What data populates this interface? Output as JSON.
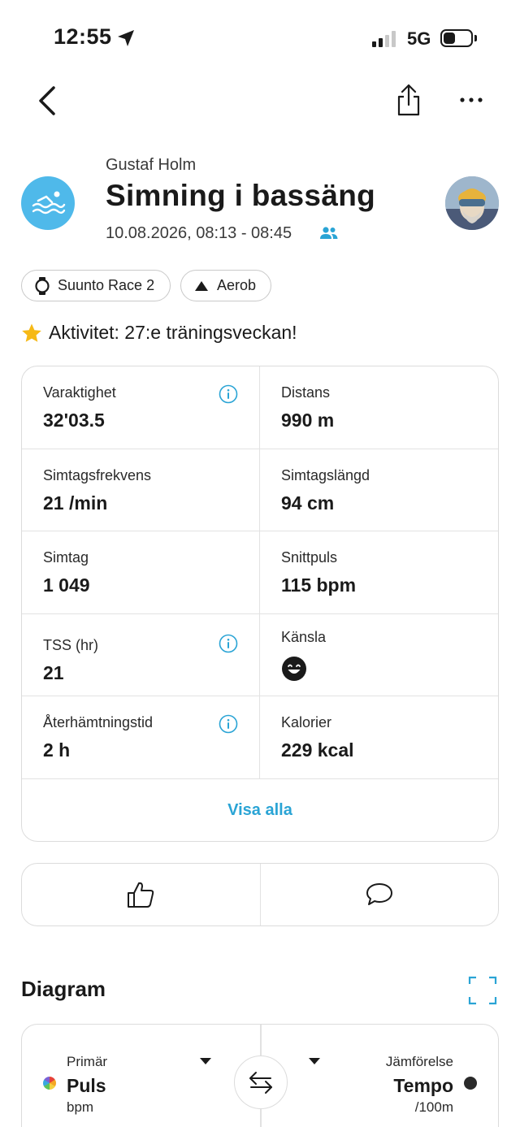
{
  "status_bar": {
    "time": "12:55",
    "network": "5G"
  },
  "header": {
    "owner": "Gustaf Holm",
    "title": "Simning i bassäng",
    "date": "10.08.2026, 08:13 - 08:45"
  },
  "chips": {
    "device": "Suunto Race 2",
    "zone": "Aerob"
  },
  "achievement": "Aktivitet: 27:e träningsveckan!",
  "stats": [
    {
      "label": "Varaktighet",
      "value": "32'03.5"
    },
    {
      "label": "Distans",
      "value": "990 m"
    },
    {
      "label": "Simtagsfrekvens",
      "value": "21 /min"
    },
    {
      "label": "Simtagslängd",
      "value": "94 cm"
    },
    {
      "label": "Simtag",
      "value": "1 049"
    },
    {
      "label": "Snittpuls",
      "value": "115 bpm"
    },
    {
      "label": "TSS (hr)",
      "value": "21"
    },
    {
      "label": "Känsla",
      "value": ""
    },
    {
      "label": "Återhämtningstid",
      "value": "2 h"
    },
    {
      "label": "Kalorier",
      "value": "229 kcal"
    }
  ],
  "show_all": "Visa alla",
  "diagram": {
    "title": "Diagram",
    "primary": {
      "label": "Primär",
      "value": "Puls",
      "unit": "bpm"
    },
    "compare": {
      "label": "Jämförelse",
      "value": "Tempo",
      "unit": "/100m"
    }
  },
  "colors": {
    "accent": "#2aa4d5",
    "sport_icon": "#4fb9ea"
  }
}
